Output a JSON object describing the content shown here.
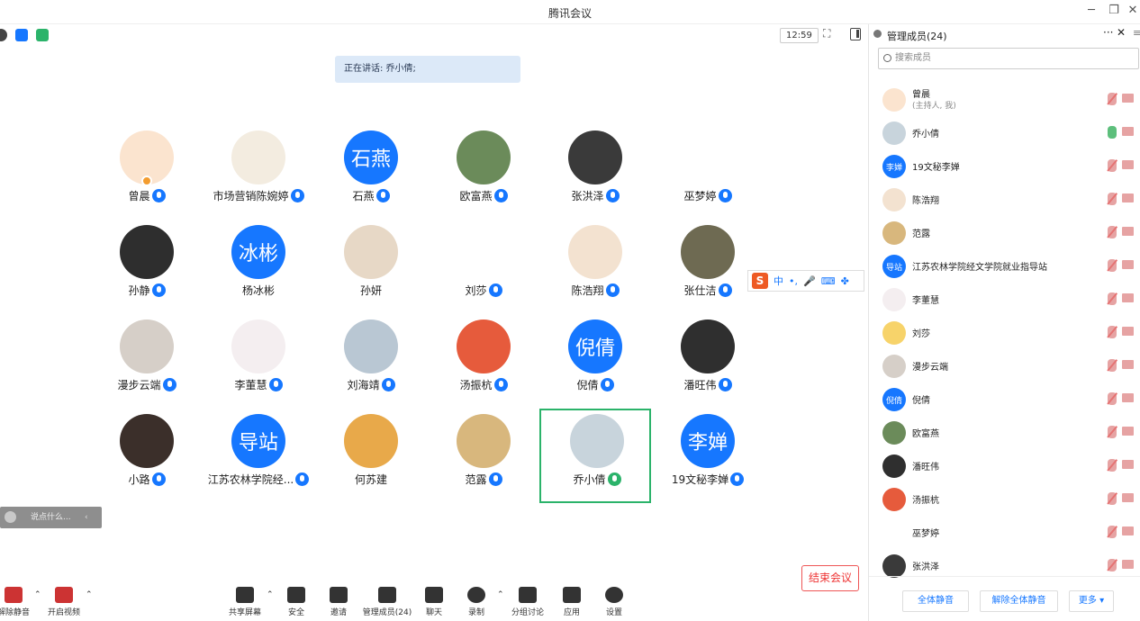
{
  "window": {
    "title": "腾讯会议",
    "minimize": "─",
    "restore": "❐",
    "close": "✕"
  },
  "topbar": {
    "time": "12:59"
  },
  "speaking": "正在讲话: 乔小倩;",
  "tiles": [
    {
      "name": "曾晨",
      "avatar_text": "",
      "avatar_color": "#fbe4cf",
      "host": true,
      "mic": true
    },
    {
      "name": "市场营销陈婉婷",
      "avatar_text": "",
      "avatar_color": "#f3ece0",
      "mic": true
    },
    {
      "name": "石燕",
      "avatar_text": "石燕",
      "avatar_color": "#1677ff",
      "mic": true
    },
    {
      "name": "欧富燕",
      "avatar_text": "",
      "avatar_color": "#6b8b5a",
      "mic": true
    },
    {
      "name": "张洪泽",
      "avatar_text": "",
      "avatar_color": "#3a3a3a",
      "mic": true
    },
    {
      "name": "巫梦婷",
      "avatar_text": "",
      "avatar_color": "#ffffff",
      "mic": true
    },
    {
      "name": "孙静",
      "avatar_text": "",
      "avatar_color": "#2e2e2e",
      "mic": true
    },
    {
      "name": "杨冰彬",
      "avatar_text": "冰彬",
      "avatar_color": "#1677ff",
      "mic": false
    },
    {
      "name": "孙妍",
      "avatar_text": "",
      "avatar_color": "#e7d8c6",
      "mic": false
    },
    {
      "name": "刘莎",
      "avatar_text": "",
      "avatar_color": "#ffffff",
      "mic": true
    },
    {
      "name": "陈浩翔",
      "avatar_text": "",
      "avatar_color": "#f3e2d0",
      "mic": true
    },
    {
      "name": "张仕洁",
      "avatar_text": "",
      "avatar_color": "#6e6a52",
      "mic": true
    },
    {
      "name": "漫步云端",
      "avatar_text": "",
      "avatar_color": "#d6cfc8",
      "mic": true
    },
    {
      "name": "李董慧",
      "avatar_text": "",
      "avatar_color": "#f4eef0",
      "mic": true
    },
    {
      "name": "刘海靖",
      "avatar_text": "",
      "avatar_color": "#b9c7d3",
      "mic": true
    },
    {
      "name": "汤振杭",
      "avatar_text": "",
      "avatar_color": "#e65b3c",
      "mic": true
    },
    {
      "name": "倪倩",
      "avatar_text": "倪倩",
      "avatar_color": "#1677ff",
      "mic": true
    },
    {
      "name": "潘旺伟",
      "avatar_text": "",
      "avatar_color": "#2f2f2f",
      "mic": true
    },
    {
      "name": "小路",
      "avatar_text": "",
      "avatar_color": "#3b2f2a",
      "mic": true
    },
    {
      "name": "江苏农林学院经...",
      "avatar_text": "导站",
      "avatar_color": "#1677ff",
      "mic": true
    },
    {
      "name": "何苏建",
      "avatar_text": "",
      "avatar_color": "#e8a94a",
      "mic": false
    },
    {
      "name": "范露",
      "avatar_text": "",
      "avatar_color": "#d8b77d",
      "mic": true
    },
    {
      "name": "乔小倩",
      "avatar_text": "",
      "avatar_color": "#c8d4dc",
      "mic": true,
      "speaking": true
    },
    {
      "name": "19文秘李婵",
      "avatar_text": "李婵",
      "avatar_color": "#1677ff",
      "mic": true
    }
  ],
  "chat": {
    "placeholder": "说点什么...",
    "collapse": "‹"
  },
  "ime": {
    "logo": "S",
    "mode": "中",
    "punct": "•,",
    "voice": "🎤",
    "keyboard": "⌨",
    "apps": "✤"
  },
  "toolbar": {
    "unmute": "解除静音",
    "video": "开启视频",
    "share": "共享屏幕",
    "security": "安全",
    "invite": "邀请",
    "members": "管理成员(24)",
    "chat": "聊天",
    "record": "录制",
    "breakout": "分组讨论",
    "apps": "应用",
    "settings": "设置",
    "end": "结束会议"
  },
  "panel": {
    "title": "管理成员(24)",
    "more": "···",
    "close": "✕",
    "scroll": "≡",
    "search_placeholder": "搜索成员",
    "members": [
      {
        "name": "曾晨",
        "sub": "(主持人, 我)",
        "avatar_text": "",
        "avatar_color": "#fbe4cf",
        "mic_on": false
      },
      {
        "name": "乔小倩",
        "avatar_text": "",
        "avatar_color": "#c8d4dc",
        "mic_on": true
      },
      {
        "name": "19文秘李婵",
        "avatar_text": "李婵",
        "avatar_color": "#1677ff",
        "mic_on": false
      },
      {
        "name": "陈浩翔",
        "avatar_text": "",
        "avatar_color": "#f3e2d0",
        "mic_on": false
      },
      {
        "name": "范露",
        "avatar_text": "",
        "avatar_color": "#d8b77d",
        "mic_on": false
      },
      {
        "name": "江苏农林学院经文学院就业指导站",
        "avatar_text": "导站",
        "avatar_color": "#1677ff",
        "mic_on": false
      },
      {
        "name": "李董慧",
        "avatar_text": "",
        "avatar_color": "#f4eef0",
        "mic_on": false
      },
      {
        "name": "刘莎",
        "avatar_text": "",
        "avatar_color": "#f7d36a",
        "mic_on": false
      },
      {
        "name": "漫步云端",
        "avatar_text": "",
        "avatar_color": "#d6cfc8",
        "mic_on": false
      },
      {
        "name": "倪倩",
        "avatar_text": "倪倩",
        "avatar_color": "#1677ff",
        "mic_on": false
      },
      {
        "name": "欧富燕",
        "avatar_text": "",
        "avatar_color": "#6b8b5a",
        "mic_on": false
      },
      {
        "name": "潘旺伟",
        "avatar_text": "",
        "avatar_color": "#2f2f2f",
        "mic_on": false
      },
      {
        "name": "汤振杭",
        "avatar_text": "",
        "avatar_color": "#e65b3c",
        "mic_on": false
      },
      {
        "name": "巫梦婷",
        "avatar_text": "",
        "avatar_color": "#ffffff",
        "mic_on": false
      },
      {
        "name": "张洪泽",
        "avatar_text": "",
        "avatar_color": "#3a3a3a",
        "mic_on": false
      }
    ],
    "mute_all": "全体静音",
    "unmute_all": "解除全体静音",
    "more_btn": "更多 ▾"
  }
}
